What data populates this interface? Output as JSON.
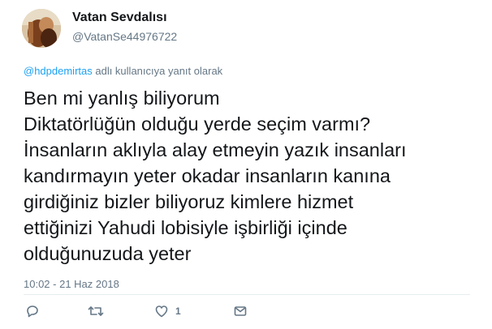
{
  "author": {
    "display_name": "Vatan Sevdalısı",
    "handle": "@VatanSe44976722"
  },
  "reply_context": {
    "mention": "@hdpdemirtas",
    "suffix": " adlı kullanıcıya yanıt olarak"
  },
  "tweet": {
    "lines": [
      "Ben mi yanlış biliyorum",
      "Diktatörlüğün olduğu yerde seçim varmı?",
      "İnsanların aklıyla alay etmeyin yazık insanları",
      "kandırmayın yeter okadar insanların kanına",
      "girdiğiniz bizler biliyoruz kimlere hizmet",
      "ettiğinizi Yahudi lobisiyle işbirliği içinde",
      "olduğunuzuda yeter"
    ],
    "timestamp": "10:02 - 21 Haz 2018"
  },
  "actions": {
    "reply_icon": "reply-icon",
    "retweet_icon": "retweet-icon",
    "like_icon": "heart-icon",
    "like_count": "1",
    "dm_icon": "envelope-icon"
  },
  "colors": {
    "text": "#14171a",
    "secondary": "#657786",
    "link": "#1da1f2",
    "divider": "#e6ecf0"
  }
}
